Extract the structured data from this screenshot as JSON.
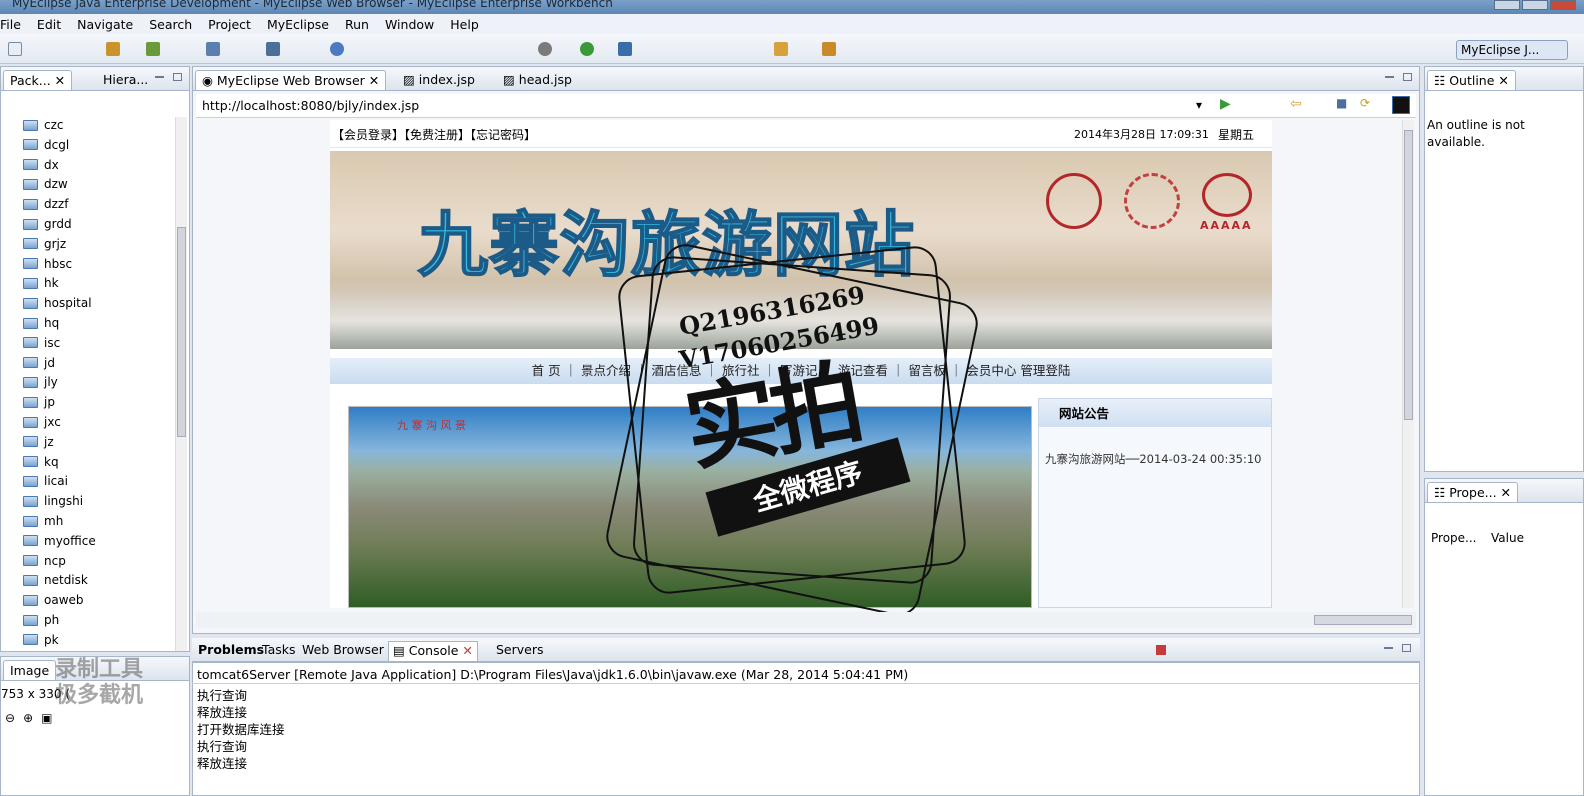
{
  "window": {
    "title": "MyEclipse Java Enterprise Development - MyEclipse Web Browser - MyEclipse Enterprise Workbench"
  },
  "menu": [
    "File",
    "Edit",
    "Navigate",
    "Search",
    "Project",
    "MyEclipse",
    "Run",
    "Window",
    "Help"
  ],
  "perspective": {
    "label": "MyEclipse J..."
  },
  "left_panel": {
    "tabs": [
      "Pack...",
      "Hiera..."
    ],
    "items": [
      "czc",
      "dcgl",
      "dx",
      "dzw",
      "dzzf",
      "grdd",
      "grjz",
      "hbsc",
      "hk",
      "hospital",
      "hq",
      "isc",
      "jd",
      "jly",
      "jp",
      "jxc",
      "jz",
      "kq",
      "licai",
      "lingshi",
      "mh",
      "myoffice",
      "ncp",
      "netdisk",
      "oaweb",
      "ph",
      "pk"
    ]
  },
  "image_panel": {
    "tab": "Image",
    "size_text": "753 x 330 ("
  },
  "editor": {
    "tabs": [
      "MyEclipse Web Browser",
      "index.jsp",
      "head.jsp"
    ],
    "url": "http://localhost:8080/bjly/index.jsp"
  },
  "site": {
    "top_links": "【会员登录】【免费注册】【忘记密码】",
    "datetime": "2014年3月28日 17:09:31",
    "weekday": "星期五",
    "banner_title": "九寨沟旅游网站",
    "banner_badge": "AAAAA",
    "nav": [
      "首 页",
      "景点介绍",
      "酒店信息",
      "旅行社",
      "写游记",
      "游记查看",
      "留言板",
      "会员中心",
      "管理登陆"
    ],
    "photo_caption": "九 寨 沟 风 景",
    "notice_title": "网站公告",
    "notice_item": "九寨沟旅游网站──2014-03-24 00:35:10"
  },
  "watermark": {
    "line1": "Q2196316269",
    "line2": "V17060256499",
    "big": "实拍",
    "ribbon": "全微程序",
    "corner": "录制工具 极多截机"
  },
  "outline": {
    "tab": "Outline",
    "message": "An outline is not available."
  },
  "properties": {
    "tab": "Prope...",
    "col1": "Prope...",
    "col2": "Value"
  },
  "bottom": {
    "tabs": [
      "Problems",
      "Tasks",
      "Web Browser",
      "Console",
      "Servers"
    ],
    "header": "tomcat6Server [Remote Java Application] D:\\Program Files\\Java\\jdk1.6.0\\bin\\javaw.exe (Mar 28, 2014 5:04:41 PM)",
    "lines": [
      "执行查询",
      "释放连接",
      "打开数据库连接",
      "执行查询",
      "释放连接"
    ]
  }
}
